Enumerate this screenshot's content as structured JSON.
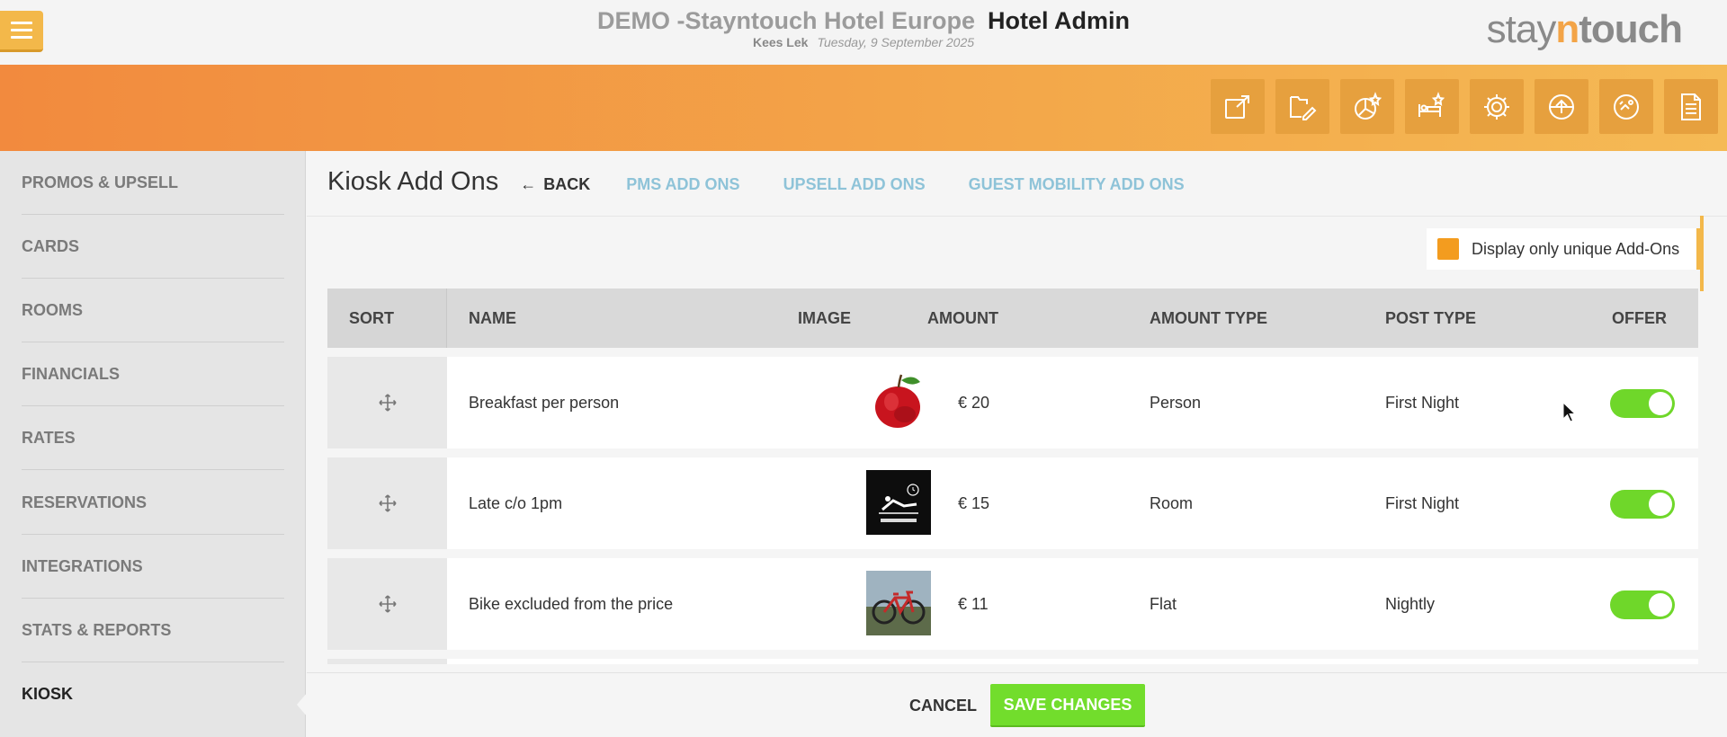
{
  "header": {
    "hotel_name": "DEMO -Stayntouch Hotel Europe",
    "section": "Hotel Admin",
    "user": "Kees Lek",
    "date": "Tuesday, 9 September 2025",
    "logo_stay": "stay",
    "logo_n": "n",
    "logo_touch": "touch"
  },
  "toolbar": [
    "external-link-icon",
    "edit-document-icon",
    "stats-star-icon",
    "room-star-icon",
    "settings-gear-icon",
    "upload-icon",
    "checkout-icon",
    "report-document-icon"
  ],
  "sidebar": {
    "items": [
      {
        "label": "PROMOS & UPSELL"
      },
      {
        "label": "CARDS"
      },
      {
        "label": "ROOMS"
      },
      {
        "label": "FINANCIALS"
      },
      {
        "label": "RATES"
      },
      {
        "label": "RESERVATIONS"
      },
      {
        "label": "INTEGRATIONS"
      },
      {
        "label": "STATS & REPORTS"
      },
      {
        "label": "KIOSK"
      }
    ],
    "active": "KIOSK"
  },
  "page": {
    "title": "Kiosk Add Ons",
    "back_label": "BACK",
    "tabs": [
      {
        "label": "PMS ADD ONS"
      },
      {
        "label": "UPSELL ADD ONS"
      },
      {
        "label": "GUEST MOBILITY ADD ONS"
      }
    ],
    "unique_filter_label": "Display only unique Add-Ons"
  },
  "table": {
    "columns": {
      "sort": "SORT",
      "name": "NAME",
      "image": "IMAGE",
      "amount": "AMOUNT",
      "amount_type": "AMOUNT TYPE",
      "post_type": "POST TYPE",
      "offer": "OFFER"
    },
    "rows": [
      {
        "name": "Breakfast per person",
        "image": "apple",
        "amount": "€ 20",
        "amount_type": "Person",
        "post_type": "First Night",
        "offer": true
      },
      {
        "name": "Late c/o 1pm",
        "image": "late-checkout",
        "amount": "€ 15",
        "amount_type": "Room",
        "post_type": "First Night",
        "offer": true
      },
      {
        "name": "Bike excluded from the price",
        "image": "bike",
        "amount": "€ 11",
        "amount_type": "Flat",
        "post_type": "Nightly",
        "offer": true
      }
    ]
  },
  "footer": {
    "cancel_label": "CANCEL",
    "save_label": "SAVE CHANGES"
  },
  "colors": {
    "accent_orange": "#f3a84a",
    "toggle_on": "#6fd72a",
    "save_green": "#72dd2c",
    "tab_link": "#8ec3d8"
  }
}
